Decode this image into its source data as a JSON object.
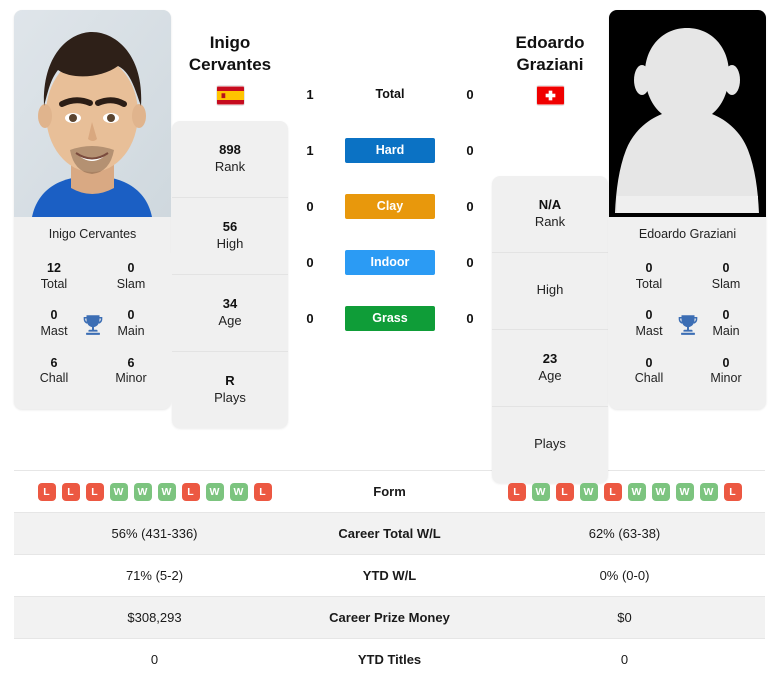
{
  "players": {
    "left": {
      "name_line1": "Inigo",
      "name_line2": "Cervantes",
      "full_name": "Inigo Cervantes",
      "photo_caption": "Inigo Cervantes",
      "country_flag": "spain-flag",
      "photo_type": "player-photo",
      "rank": "898",
      "rank_label": "Rank",
      "high": "56",
      "high_label": "High",
      "age": "34",
      "age_label": "Age",
      "plays": "R",
      "plays_label": "Plays",
      "titles": {
        "total": "12",
        "total_label": "Total",
        "slam": "0",
        "slam_label": "Slam",
        "mast": "0",
        "mast_label": "Mast",
        "main": "0",
        "main_label": "Main",
        "chall": "6",
        "chall_label": "Chall",
        "minor": "6",
        "minor_label": "Minor"
      },
      "form": [
        "L",
        "L",
        "L",
        "W",
        "W",
        "W",
        "L",
        "W",
        "W",
        "L"
      ],
      "career_total_wl": "56% (431-336)",
      "ytd_wl": "71% (5-2)",
      "career_prize_money": "$308,293",
      "ytd_titles": "0"
    },
    "right": {
      "name_line1": "Edoardo",
      "name_line2": "Graziani",
      "full_name": "Edoardo Graziani",
      "photo_caption": "Edoardo Graziani",
      "country_flag": "switzerland-flag",
      "photo_type": "player-photo-placeholder-silhouette",
      "rank": "N/A",
      "rank_label": "Rank",
      "high": "",
      "high_label": "High",
      "age": "23",
      "age_label": "Age",
      "plays": "",
      "plays_label": "Plays",
      "titles": {
        "total": "0",
        "total_label": "Total",
        "slam": "0",
        "slam_label": "Slam",
        "mast": "0",
        "mast_label": "Mast",
        "main": "0",
        "main_label": "Main",
        "chall": "0",
        "chall_label": "Chall",
        "minor": "0",
        "minor_label": "Minor"
      },
      "form": [
        "L",
        "W",
        "L",
        "W",
        "L",
        "W",
        "W",
        "W",
        "W",
        "L"
      ],
      "career_total_wl": "62% (63-38)",
      "ytd_wl": "0% (0-0)",
      "career_prize_money": "$0",
      "ytd_titles": "0"
    }
  },
  "head_to_head": {
    "rows": [
      {
        "label": "Total",
        "left": "1",
        "right": "0",
        "color": "",
        "plain": true
      },
      {
        "label": "Hard",
        "left": "1",
        "right": "0",
        "color": "#0b72c4",
        "plain": false
      },
      {
        "label": "Clay",
        "left": "0",
        "right": "0",
        "color": "#e8980c",
        "plain": false
      },
      {
        "label": "Indoor",
        "left": "0",
        "right": "0",
        "color": "#2b9bf4",
        "plain": false
      },
      {
        "label": "Grass",
        "left": "0",
        "right": "0",
        "color": "#0f9d38",
        "plain": false
      }
    ]
  },
  "comparison_table": {
    "rows": [
      {
        "label": "Form",
        "type": "form",
        "left": "",
        "right": ""
      },
      {
        "label": "Career Total W/L",
        "type": "text",
        "left": "56% (431-336)",
        "right": "62% (63-38)"
      },
      {
        "label": "YTD W/L",
        "type": "text",
        "left": "71% (5-2)",
        "right": "0% (0-0)"
      },
      {
        "label": "Career Prize Money",
        "type": "text",
        "left": "$308,293",
        "right": "$0"
      },
      {
        "label": "YTD Titles",
        "type": "text",
        "left": "0",
        "right": "0"
      }
    ]
  },
  "colors": {
    "hard": "#0b72c4",
    "clay": "#e8980c",
    "indoor": "#2b9bf4",
    "grass": "#0f9d38",
    "win_badge": "#7cc47f",
    "loss_badge": "#ec5842",
    "card_bg": "#f0f0f0",
    "alt_row_bg": "#f2f2f2",
    "trophy": "#3c6eb4"
  },
  "icons": {
    "trophy": "trophy-icon"
  }
}
